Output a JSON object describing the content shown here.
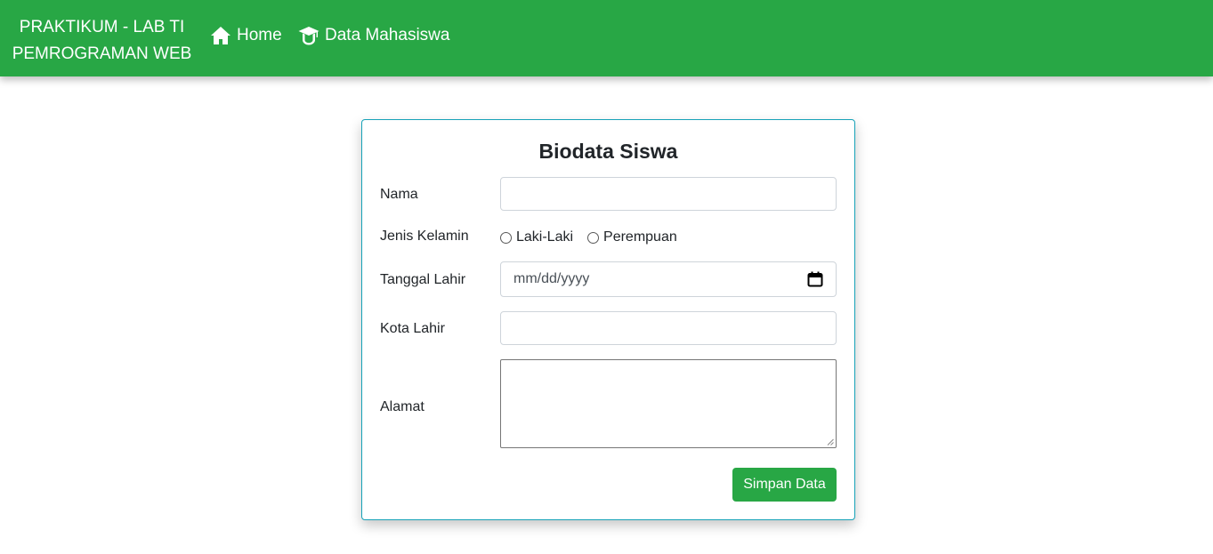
{
  "navbar": {
    "brand_line1": "PRAKTIKUM - LAB TI",
    "brand_line2": "PEMROGRAMAN WEB",
    "links": [
      {
        "label": "Home",
        "icon": "home-icon"
      },
      {
        "label": "Data Mahasiswa",
        "icon": "graduation-cap-icon"
      }
    ],
    "color": "#28a745"
  },
  "form": {
    "title": "Biodata Siswa",
    "nama_label": "Nama",
    "nama_value": "",
    "jenis_kelamin_label": "Jenis Kelamin",
    "gender_options": [
      "Laki-Laki",
      "Perempuan"
    ],
    "tanggal_lahir_label": "Tanggal Lahir",
    "tanggal_lahir_placeholder": "mm/dd/yyyy",
    "kota_lahir_label": "Kota Lahir",
    "kota_lahir_value": "",
    "alamat_label": "Alamat",
    "alamat_value": "",
    "submit_label": "Simpan Data",
    "border_color": "#17a2b8"
  }
}
